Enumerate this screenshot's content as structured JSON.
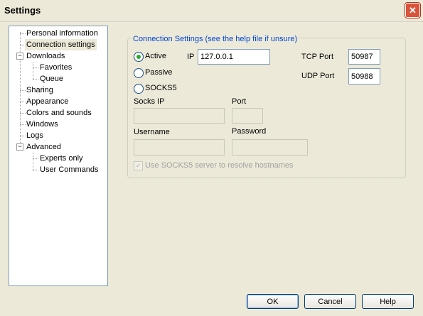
{
  "window": {
    "title": "Settings",
    "close_glyph": "✕"
  },
  "tree": {
    "items": [
      {
        "label": "Personal information"
      },
      {
        "label": "Connection settings"
      },
      {
        "label": "Downloads"
      },
      {
        "label": "Favorites"
      },
      {
        "label": "Queue"
      },
      {
        "label": "Sharing"
      },
      {
        "label": "Appearance"
      },
      {
        "label": "Colors and sounds"
      },
      {
        "label": "Windows"
      },
      {
        "label": "Logs"
      },
      {
        "label": "Advanced"
      },
      {
        "label": "Experts only"
      },
      {
        "label": "User Commands"
      }
    ],
    "expander_glyph": "−",
    "selected": "Connection settings"
  },
  "connection": {
    "group_label": "Connection Settings (see the help file if unsure)",
    "modes": {
      "active": "Active",
      "passive": "Passive",
      "socks5": "SOCKS5",
      "selected": "Active"
    },
    "ip_label": "IP",
    "ip_value": "127.0.0.1",
    "tcp_label": "TCP Port",
    "tcp_value": "50987",
    "udp_label": "UDP Port",
    "udp_value": "50988",
    "socks_ip_label": "Socks IP",
    "port_label": "Port",
    "username_label": "Username",
    "password_label": "Password",
    "resolve_label": "Use SOCKS5 server to resolve hostnames",
    "resolve_checked": true
  },
  "buttons": {
    "ok": "OK",
    "cancel": "Cancel",
    "help": "Help"
  },
  "colors": {
    "accent": "#0046d5",
    "close": "#d9543a",
    "radio_dot": "#2dab2d"
  },
  "icons": {
    "close": "close-icon",
    "expander": "minus-expander-icon",
    "check": "checkmark-icon"
  }
}
